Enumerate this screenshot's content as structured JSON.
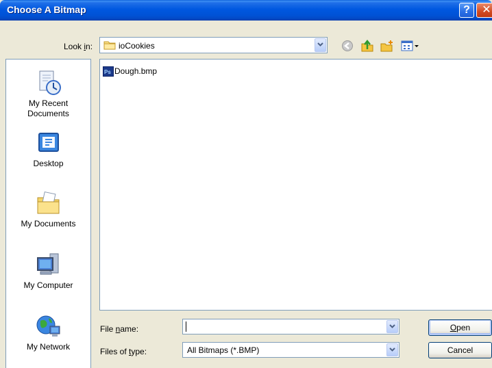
{
  "window": {
    "title": "Choose A Bitmap",
    "help_glyph": "?",
    "close_glyph": "✕"
  },
  "lookin": {
    "label_pre": "Look ",
    "label_key": "i",
    "label_post": "n:",
    "value": "ioCookies"
  },
  "toolbar": {
    "icons": [
      "back-icon",
      "up-folder-icon",
      "new-folder-icon",
      "views-menu-icon"
    ]
  },
  "places": [
    {
      "label_line1": "My Recent",
      "label_line2": "Documents",
      "icon": "recent-documents-icon"
    },
    {
      "label_line1": "Desktop",
      "label_line2": "",
      "icon": "desktop-icon"
    },
    {
      "label_line1": "My Documents",
      "label_line2": "",
      "icon": "my-documents-icon"
    },
    {
      "label_line1": "My Computer",
      "label_line2": "",
      "icon": "my-computer-icon"
    },
    {
      "label_line1": "My Network",
      "label_line2": "",
      "icon": "my-network-icon"
    }
  ],
  "files": [
    {
      "name": "Dough.bmp",
      "icon": "photoshop-bmp-icon",
      "icon_text": "Ps"
    }
  ],
  "filename": {
    "label_pre": "File ",
    "label_key": "n",
    "label_post": "ame:",
    "value": ""
  },
  "filetype": {
    "label_pre": "Files of ",
    "label_key": "t",
    "label_post": "ype:",
    "value": "All Bitmaps (*.BMP)"
  },
  "buttons": {
    "open_key": "O",
    "open_rest": "pen",
    "cancel": "Cancel"
  },
  "colors": {
    "titlebar": "#0058e0",
    "dialog_bg": "#ece9d8",
    "field_border": "#7f9db9"
  }
}
